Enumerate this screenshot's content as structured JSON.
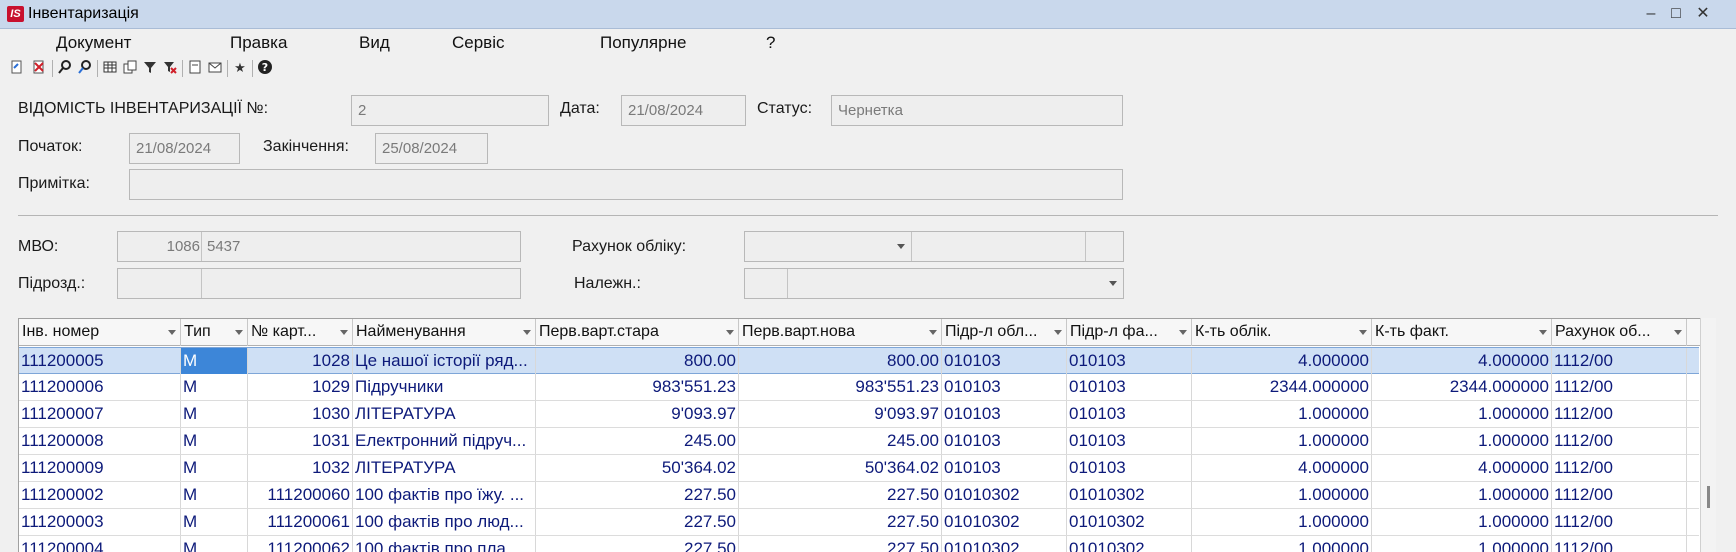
{
  "window": {
    "title": "Інвентаризація",
    "logo": "IS"
  },
  "menu": [
    "Документ",
    "Правка",
    "Вид",
    "Сервіс",
    "Популярне",
    "?"
  ],
  "toolbar_icons": [
    "add-doc-icon",
    "delete-doc-icon",
    "search-icon",
    "find-next-icon",
    "table-icon",
    "copy-icon",
    "filter-icon",
    "clear-filter-icon",
    "page-icon",
    "mail-icon",
    "star-icon",
    "help-icon"
  ],
  "form": {
    "doc_label": "ВІДОМІСТЬ ІНВЕНТАРИЗАЦІЇ  №:",
    "doc_no": "2",
    "date_label": "Дата:",
    "date": "21/08/2024",
    "status_label": "Статус:",
    "status": "Чернетка",
    "start_label": "Початок:",
    "start": "21/08/2024",
    "end_label": "Закінчення:",
    "end": "25/08/2024",
    "note_label": "Примітка:",
    "note": "",
    "mvo_label": "МВО:",
    "mvo_code": "1086",
    "mvo_name": "5437",
    "account_label": "Рахунок обліку:",
    "account": "",
    "subdiv_label": "Підрозд.:",
    "subdiv_code": "",
    "subdiv_name": "",
    "belong_label": "Належн.:",
    "belong": ""
  },
  "grid": {
    "columns": [
      "Інв. номер",
      "Тип",
      "№ картки",
      "Найменування",
      "Перв.варт.стара",
      "Перв.варт.нова",
      "Підр-л обліку",
      "Підр-л факт.",
      "К-ть облік.",
      "К-ть факт.",
      "Рахунок обліку"
    ],
    "column_titles": [
      "Інв. номер",
      "Тип",
      "№ карт...",
      "Найменування",
      "Перв.варт.стара",
      "Перв.варт.нова",
      "Підр-л обл...",
      "Підр-л фа...",
      "К-ть облік.",
      "К-ть факт.",
      "Рахунок об..."
    ],
    "rows": [
      [
        "111200005",
        "М",
        "1028",
        "Це нашої історії ряд...",
        "800.00",
        "800.00",
        "010103",
        "010103",
        "4.000000",
        "4.000000",
        "1112/00"
      ],
      [
        "111200006",
        "М",
        "1029",
        "Підручники",
        "983'551.23",
        "983'551.23",
        "010103",
        "010103",
        "2344.000000",
        "2344.000000",
        "1112/00"
      ],
      [
        "111200007",
        "М",
        "1030",
        "ЛІТЕРАТУРА",
        "9'093.97",
        "9'093.97",
        "010103",
        "010103",
        "1.000000",
        "1.000000",
        "1112/00"
      ],
      [
        "111200008",
        "М",
        "1031",
        "Електронний підруч...",
        "245.00",
        "245.00",
        "010103",
        "010103",
        "1.000000",
        "1.000000",
        "1112/00"
      ],
      [
        "111200009",
        "М",
        "1032",
        "ЛІТЕРАТУРА",
        "50'364.02",
        "50'364.02",
        "010103",
        "010103",
        "4.000000",
        "4.000000",
        "1112/00"
      ],
      [
        "111200002",
        "М",
        "111200060",
        "100 фактів про їжу. ...",
        "227.50",
        "227.50",
        "01010302",
        "01010302",
        "1.000000",
        "1.000000",
        "1112/00"
      ],
      [
        "111200003",
        "М",
        "111200061",
        "100 фактів про люд...",
        "227.50",
        "227.50",
        "01010302",
        "01010302",
        "1.000000",
        "1.000000",
        "1112/00"
      ],
      [
        "111200004",
        "М",
        "111200062",
        "100 фактів про пла...",
        "227.50",
        "227.50",
        "01010302",
        "01010302",
        "1.000000",
        "1.000000",
        "1112/00"
      ]
    ],
    "selected_row": 0
  }
}
